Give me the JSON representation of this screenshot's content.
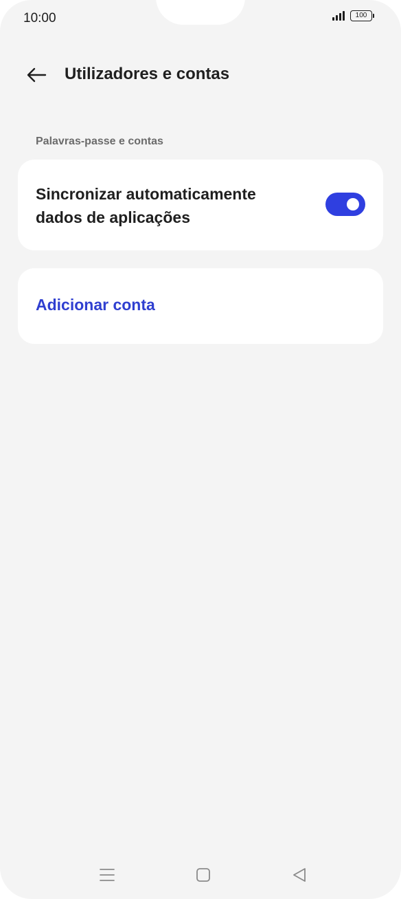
{
  "status_bar": {
    "time": "10:00",
    "battery": "100",
    "icons": [
      "signal-icon",
      "battery-icon"
    ]
  },
  "header": {
    "back_icon": "arrow-left-icon",
    "title": "Utilizadores e contas"
  },
  "section": {
    "label": "Palavras-passe e contas"
  },
  "sync_setting": {
    "label": "Sincronizar automaticamente dados de aplicações",
    "enabled": true
  },
  "add_account": {
    "label": "Adicionar conta"
  },
  "nav_bar": {
    "icons": [
      "menu-icon",
      "home-icon",
      "back-triangle-icon"
    ]
  },
  "colors": {
    "accent": "#2f3fe0",
    "link": "#2f3fd0",
    "background": "#f4f4f4",
    "card": "#ffffff"
  }
}
